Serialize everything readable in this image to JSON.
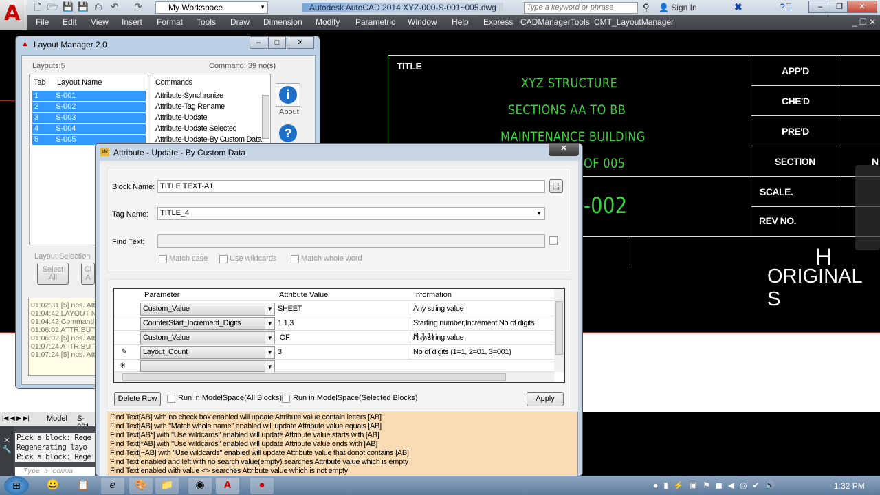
{
  "app": {
    "title": "Autodesk AutoCAD 2014    XYZ-000-S-001~005.dwg",
    "workspace": "My Workspace",
    "search_placeholder": "Type a keyword or phrase",
    "sign_in": "Sign In",
    "menu": [
      "File",
      "Edit",
      "View",
      "Insert",
      "Format",
      "Tools",
      "Draw",
      "Dimension",
      "Modify",
      "Parametric",
      "Window",
      "Help",
      "Express",
      "CADManagerTools",
      "CMT_LayoutManager"
    ]
  },
  "drawing": {
    "title_label": "TITLE",
    "lines": [
      "XYZ STRUCTURE",
      "SECTIONS AA TO BB",
      "MAINTENANCE BUILDING",
      "OF 005"
    ],
    "number": "-002",
    "fields": [
      "APP'D",
      "CHE'D",
      "PRE'D",
      "SECTION",
      "SCALE.",
      "REV NO."
    ],
    "partial_cell": "N",
    "big_letter": "H",
    "original": "ORIGINAL S"
  },
  "layout_tabs": {
    "model": "Model",
    "first": "S-001"
  },
  "command_line": {
    "history": [
      "Pick a block: Rege",
      "Regenerating layo",
      "Pick a block: Rege"
    ],
    "placeholder": "Type a comma"
  },
  "layout_manager": {
    "title": "Layout Manager  2.0",
    "layouts_count": "Layouts:5",
    "command_count": "Command: 39 no(s)",
    "columns": [
      "Tab",
      "Layout Name"
    ],
    "layouts": [
      {
        "tab": "1",
        "name": "S-001"
      },
      {
        "tab": "2",
        "name": "S-002"
      },
      {
        "tab": "3",
        "name": "S-003"
      },
      {
        "tab": "4",
        "name": "S-004"
      },
      {
        "tab": "5",
        "name": "S-005"
      }
    ],
    "commands_header": "Commands",
    "commands": [
      "Attribute-Synchronize",
      "Attribute-Tag Rename",
      "Attribute-Update",
      "Attribute-Update Selected",
      "Attribute-Update-By Custom Data"
    ],
    "about": "About",
    "layout_selection": "Layout Selection",
    "select_all": "Select All",
    "clear_all": "Cl A",
    "log": [
      "01:02:31  [5] nos. Att",
      "01:04:42  LAYOUT N",
      "01:04:42  Command",
      "01:06:02  ATTRIBUT",
      "01:06:02  [5] nos. Att",
      "01:07:24  ATTRIBUT",
      "01:07:24  [5] nos. Att"
    ]
  },
  "dialog": {
    "title": "Attribute - Update - By Custom Data",
    "block_name_label": "Block Name:",
    "block_name": "TITLE TEXT-A1",
    "tag_name_label": "Tag Name:",
    "tag_name": "TITLE_4",
    "find_text_label": "Find Text:",
    "find_text": "",
    "match_case": "Match case",
    "use_wildcards": "Use wildcards",
    "match_whole_word": "Match whole word",
    "grid_columns": [
      "Parameter",
      "Attribute Value",
      "Information"
    ],
    "rows": [
      {
        "parameter": "Custom_Value",
        "value": "SHEET",
        "info": "Any string value"
      },
      {
        "parameter": "CounterStart_Increment_Digits",
        "value": "1,1,3",
        "info": "Starting number,Increment,No of digits (1,1,1)"
      },
      {
        "parameter": "Custom_Value",
        "value": " OF",
        "info": "Any string value"
      },
      {
        "parameter": "Layout_Count",
        "value": "3",
        "info": "No of digits (1=1, 2=01, 3=001)"
      }
    ],
    "delete_row": "Delete Row",
    "run_all": "Run in ModelSpace(All Blocks)",
    "run_selected": "Run in ModelSpace(Selected Blocks)",
    "apply": "Apply",
    "help": [
      "Find Text[AB] with no check box enabled will update Attribute value contain letters [AB]",
      "Find Text[AB] with \"Match whole name\" enabled will update Attribute value equals [AB]",
      "Find Text[AB*] with \"Use wildcards\" enabled will update Attribute value starts with [AB]",
      "Find Text[*AB] with \"Use wildcards\" enabled will update Attribute value ends with [AB]",
      "Find Text[~AB] with \"Use wildcards\" enabled will update Attribute value that donot contains [AB]",
      "Find Text enabled and  left with no search value(empty) searches Attribute value which is empty",
      "Find Text enabled with value <> searches Attribute value which is not empty"
    ]
  },
  "taskbar": {
    "clock": "1:32 PM"
  }
}
